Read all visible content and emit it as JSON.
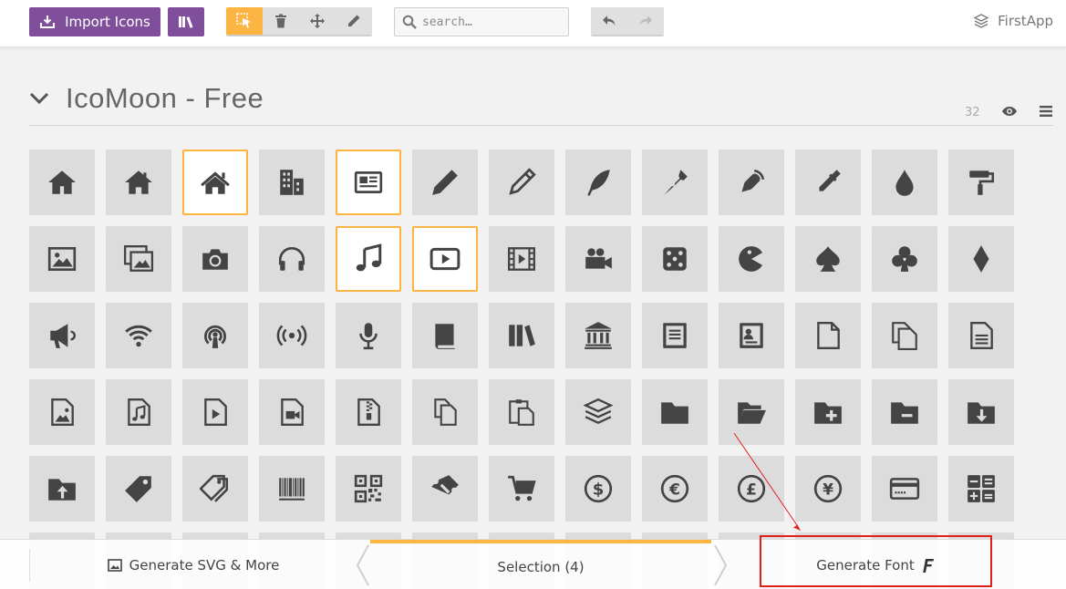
{
  "toolbar": {
    "import_label": "Import Icons",
    "search_placeholder": "search…",
    "project_name": "FirstApp",
    "icons": {
      "import": "import-icon",
      "library": "library-icon",
      "select": "select-pointer-icon",
      "delete": "trash-icon",
      "move": "move-icon",
      "edit": "pencil-icon",
      "search": "search-icon",
      "undo": "undo-icon",
      "redo": "redo-icon",
      "project": "layers-icon"
    },
    "active_tool": "select"
  },
  "set": {
    "title": "IcoMoon - Free",
    "count": "32"
  },
  "icon_grid": {
    "rows": [
      [
        "home",
        "home2",
        "home3",
        "office",
        "newspaper",
        "pencil",
        "pencil2",
        "quill",
        "pen",
        "blog",
        "eyedropper",
        "droplet",
        "paint-format"
      ],
      [
        "image",
        "images",
        "camera",
        "headphones",
        "music",
        "play",
        "film",
        "video-camera",
        "dice",
        "pacman",
        "spades",
        "clubs",
        "diamonds"
      ],
      [
        "bullhorn",
        "connection",
        "podcast",
        "feed",
        "mic",
        "book",
        "books",
        "library",
        "file-text",
        "profile",
        "file-empty",
        "files-empty",
        "file-text2"
      ],
      [
        "file-picture",
        "file-music",
        "file-play",
        "file-video",
        "file-zip",
        "copy",
        "paste",
        "stack",
        "folder",
        "folder-open",
        "folder-plus",
        "folder-minus",
        "folder-download"
      ],
      [
        "folder-upload",
        "price-tag",
        "price-tags",
        "barcode",
        "qrcode",
        "ticket",
        "cart",
        "coin-dollar",
        "coin-euro",
        "coin-pound",
        "coin-yen",
        "credit-card",
        "calculator"
      ]
    ],
    "selected": [
      "home3",
      "newspaper",
      "music",
      "play"
    ]
  },
  "bottom_bar": {
    "svg_label": "Generate SVG & More",
    "selection_label": "Selection (4)",
    "font_label": "Generate Font",
    "font_icon": "font-f-icon"
  },
  "colors": {
    "accent": "#fcb443",
    "brand": "#7f4f9b",
    "annotation": "#e0201b"
  }
}
